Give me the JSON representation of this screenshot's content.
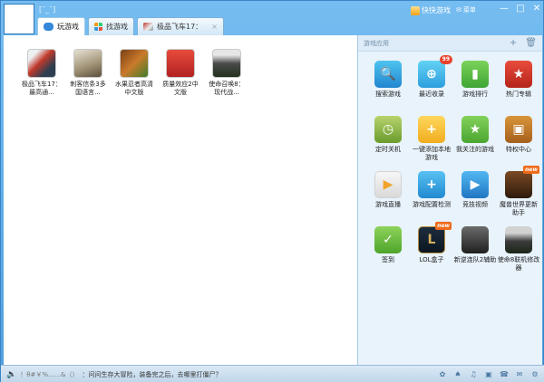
{
  "window": {
    "username": "[¯_¯]",
    "app_title": "快快游戏",
    "msg_label": "菜单",
    "minimize_label": "—",
    "maximize_label": "□",
    "close_label": "✕"
  },
  "tabs": [
    {
      "label": "玩游戏"
    },
    {
      "label": "找游戏"
    },
    {
      "label": "极品飞车17：",
      "close": "×"
    }
  ],
  "games": [
    {
      "label": "极品飞车17：最高通..."
    },
    {
      "label": "刺客信条3多国语言..."
    },
    {
      "label": "水果忍者高清中文版"
    },
    {
      "label": "质量效应2中文版"
    },
    {
      "label": "使命召唤8：现代战..."
    }
  ],
  "side_panel": {
    "title": "游戏应用",
    "add_label": "+",
    "delete_label": "🗑",
    "apps": [
      {
        "label": "搜索游戏",
        "icon": "search-icon",
        "glyph": "🔍"
      },
      {
        "label": "最近收录",
        "icon": "recent-icon",
        "glyph": "⊕",
        "badge": "99"
      },
      {
        "label": "游戏排行",
        "icon": "rank-icon",
        "glyph": "▮"
      },
      {
        "label": "热门专辑",
        "icon": "hot-album-icon",
        "glyph": "★"
      },
      {
        "label": "定时关机",
        "icon": "clock-icon",
        "glyph": "◷"
      },
      {
        "label": "一键添加本地游戏",
        "icon": "folder-add-icon",
        "glyph": "+"
      },
      {
        "label": "我关注的游戏",
        "icon": "star-icon",
        "glyph": "★"
      },
      {
        "label": "特权中心",
        "icon": "chest-icon",
        "glyph": "▣"
      },
      {
        "label": "游戏直播",
        "icon": "live-icon",
        "glyph": "▶"
      },
      {
        "label": "游戏配置检测",
        "icon": "config-check-icon",
        "glyph": "+"
      },
      {
        "label": "竞技视频",
        "icon": "video-icon",
        "glyph": "▶"
      },
      {
        "label": "魔兽世界更新助手",
        "icon": "wow-icon",
        "glyph": "",
        "new": "new"
      },
      {
        "label": "签到",
        "icon": "checkin-icon",
        "glyph": "✓"
      },
      {
        "label": "LOL盒子",
        "icon": "lol-icon",
        "glyph": "L",
        "new": "new"
      },
      {
        "label": "新逆连队2辅助",
        "icon": "battlefield-icon",
        "glyph": ""
      },
      {
        "label": "使命8联机修改器",
        "icon": "cod-icon",
        "glyph": ""
      }
    ]
  },
  "status": {
    "speaker": "🔈",
    "emote": "！θ#￥%……&（）",
    "text": "：问问生存大冒险，装备完之后，去哪里打僵尸？"
  },
  "colors": {
    "window_blue": "#5ea7df",
    "panel_bg": "#e8f3fb"
  }
}
